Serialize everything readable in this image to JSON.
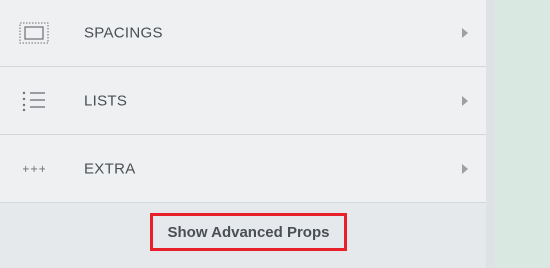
{
  "menu": {
    "items": [
      {
        "label": "SPACINGS",
        "icon": "spacing-box-icon"
      },
      {
        "label": "LISTS",
        "icon": "list-icon"
      },
      {
        "label": "EXTRA",
        "icon": "more-dots-icon"
      }
    ]
  },
  "footer": {
    "advanced_button_label": "Show Advanced Props"
  },
  "colors": {
    "panel_bg": "#eef0f1",
    "footer_bg": "#e6e9eb",
    "highlight_border": "#e8202a",
    "canvas_bg": "#d9e8e1",
    "text": "#4a4f54"
  }
}
